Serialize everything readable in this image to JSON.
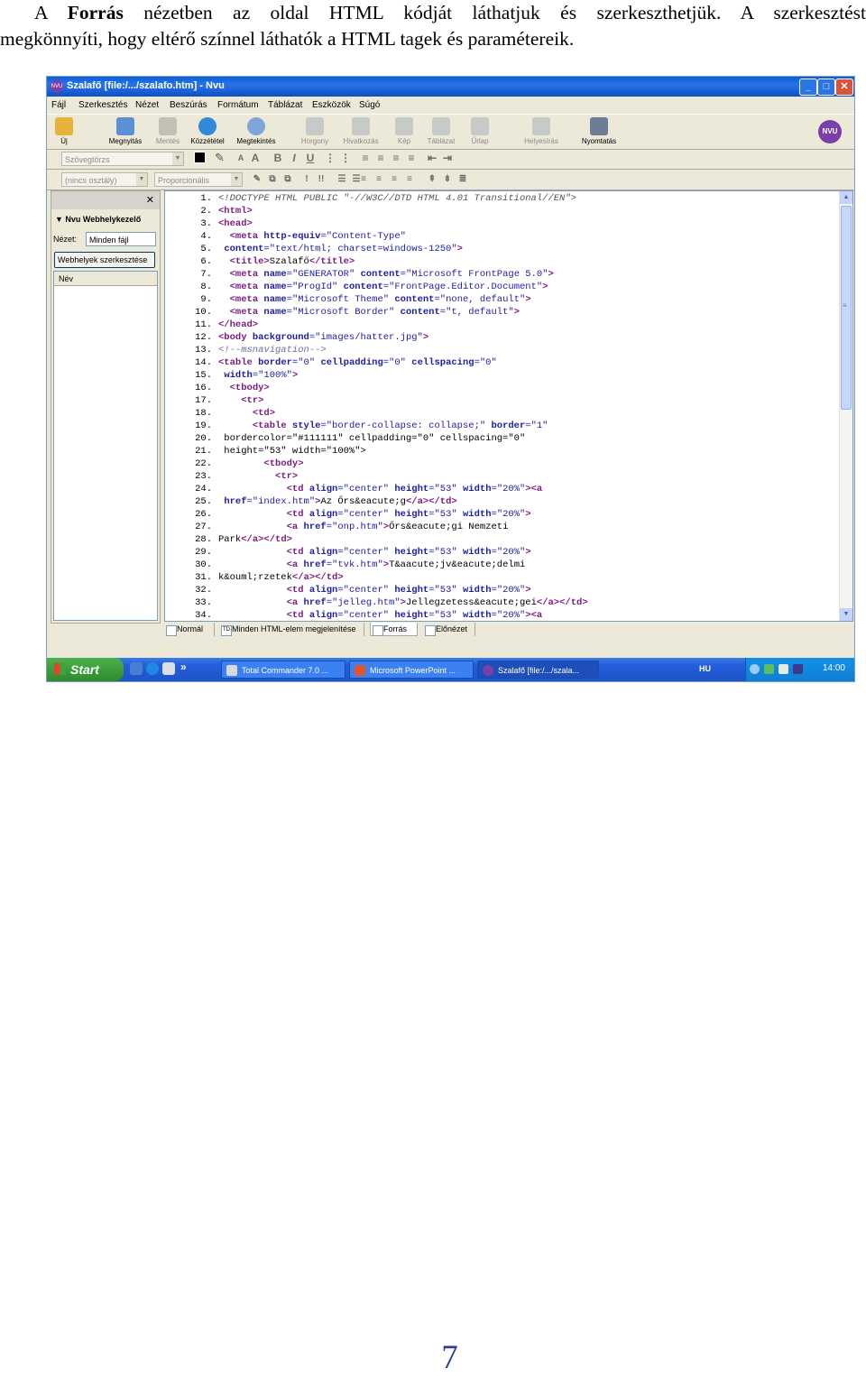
{
  "intro": {
    "p1": "A ",
    "bold": "Forrás",
    "p2": " nézetben az oldal HTML kódját láthatjuk és szerkeszthetjük. A szerkesztést",
    "line2": "megkönnyíti, hogy eltérő színnel láthatók a HTML tagek és paramétereik."
  },
  "window": {
    "title": "Szalafő [file:/.../szalafo.htm] - Nvu",
    "icon_text": "NVU",
    "minimize": "_",
    "maximize": "□",
    "close": "✕"
  },
  "menu": [
    "Fájl",
    "Szerkesztés",
    "Nézet",
    "Beszúrás",
    "Formátum",
    "Táblázat",
    "Eszközök",
    "Súgó"
  ],
  "toolbar": [
    {
      "label": "Új",
      "icon": "new-file-icon",
      "color": "#e8b23a",
      "enabled": true
    },
    {
      "label": "Megnyitás",
      "icon": "open-folder-icon",
      "color": "#5b8fd6",
      "enabled": true
    },
    {
      "label": "Mentés",
      "icon": "save-disk-icon",
      "color": "#8d8d8d",
      "enabled": false
    },
    {
      "label": "Közzététel",
      "icon": "publish-globe-icon",
      "color": "#2f8ad8",
      "enabled": true
    },
    {
      "label": "Megtekintés",
      "icon": "browse-magnifier-icon",
      "color": "#7ea6d8",
      "enabled": true
    },
    {
      "label": "Horgony",
      "icon": "anchor-icon",
      "color": "#9aa7b8",
      "enabled": false
    },
    {
      "label": "Hivatkozás",
      "icon": "link-chain-icon",
      "color": "#9aa7b8",
      "enabled": false
    },
    {
      "label": "Kép",
      "icon": "image-icon",
      "color": "#9aa7b8",
      "enabled": false
    },
    {
      "label": "Táblázat",
      "icon": "table-icon",
      "color": "#9aa7b8",
      "enabled": false
    },
    {
      "label": "Űrlap",
      "icon": "form-icon",
      "color": "#9aa7b8",
      "enabled": false
    },
    {
      "label": "Helyesírás",
      "icon": "spellcheck-icon",
      "color": "#9aa7b8",
      "enabled": false
    },
    {
      "label": "Nyomtatás",
      "icon": "printer-icon",
      "color": "#6d7d95",
      "enabled": true
    }
  ],
  "nvu_logo": "NVU",
  "format": {
    "paragraph_placeholder": "Szövegtörzs",
    "class_placeholder": "(nincs osztály)",
    "font_placeholder": "Proporcionális",
    "buttons_row2": [
      "A",
      "A",
      "B",
      "I",
      "U",
      "⋮",
      "⋮",
      "≡",
      "≡",
      "≡",
      "≡",
      "⇤",
      "⇥"
    ],
    "buttons_row3": [
      "✎",
      "⧉",
      "⧉",
      "!",
      "!!",
      "☰",
      "☰",
      "≡",
      "≡",
      "≡",
      "≡",
      "↕",
      "↔",
      "↕",
      "⇞",
      "⇟",
      "≣"
    ]
  },
  "sidebar": {
    "close": "✕",
    "manager_title": "▼ Nvu Webhelykezelő",
    "view_label": "Nézet:",
    "view_value": "Minden fájl",
    "edit_sites_button": "Webhelyek szerkesztése",
    "column_name": "Név"
  },
  "code_lines": [
    {
      "n": "1.",
      "parts": [
        {
          "c": "c-dt",
          "t": "<!DOCTYPE HTML PUBLIC \"-//W3C//DTD HTML 4.01 Transitional//EN\">"
        }
      ]
    },
    {
      "n": "2.",
      "parts": [
        {
          "c": "c-tag",
          "t": "<html>"
        }
      ]
    },
    {
      "n": "3.",
      "parts": [
        {
          "c": "c-tag",
          "t": "<head>"
        }
      ]
    },
    {
      "n": "4.",
      "parts": [
        {
          "c": "c-tx",
          "t": "  "
        },
        {
          "c": "c-tag",
          "t": "<meta "
        },
        {
          "c": "c-at",
          "t": "http-equiv"
        },
        {
          "c": "c-val",
          "t": "=\"Content-Type\""
        }
      ]
    },
    {
      "n": "5.",
      "parts": [
        {
          "c": "c-tx",
          "t": " "
        },
        {
          "c": "c-at",
          "t": "content"
        },
        {
          "c": "c-val",
          "t": "=\"text/html; charset=windows-1250\""
        },
        {
          "c": "c-tag",
          "t": ">"
        }
      ]
    },
    {
      "n": "6.",
      "parts": [
        {
          "c": "c-tx",
          "t": "  "
        },
        {
          "c": "c-tag",
          "t": "<title>"
        },
        {
          "c": "c-tx",
          "t": "Szalafő"
        },
        {
          "c": "c-tag",
          "t": "</title>"
        }
      ]
    },
    {
      "n": "7.",
      "parts": [
        {
          "c": "c-tx",
          "t": "  "
        },
        {
          "c": "c-tag",
          "t": "<meta "
        },
        {
          "c": "c-at",
          "t": "name"
        },
        {
          "c": "c-val",
          "t": "=\"GENERATOR\" "
        },
        {
          "c": "c-at",
          "t": "content"
        },
        {
          "c": "c-val",
          "t": "=\"Microsoft FrontPage 5.0\""
        },
        {
          "c": "c-tag",
          "t": ">"
        }
      ]
    },
    {
      "n": "8.",
      "parts": [
        {
          "c": "c-tx",
          "t": "  "
        },
        {
          "c": "c-tag",
          "t": "<meta "
        },
        {
          "c": "c-at",
          "t": "name"
        },
        {
          "c": "c-val",
          "t": "=\"ProgId\" "
        },
        {
          "c": "c-at",
          "t": "content"
        },
        {
          "c": "c-val",
          "t": "=\"FrontPage.Editor.Document\""
        },
        {
          "c": "c-tag",
          "t": ">"
        }
      ]
    },
    {
      "n": "9.",
      "parts": [
        {
          "c": "c-tx",
          "t": "  "
        },
        {
          "c": "c-tag",
          "t": "<meta "
        },
        {
          "c": "c-at",
          "t": "name"
        },
        {
          "c": "c-val",
          "t": "=\"Microsoft Theme\" "
        },
        {
          "c": "c-at",
          "t": "content"
        },
        {
          "c": "c-val",
          "t": "=\"none, default\""
        },
        {
          "c": "c-tag",
          "t": ">"
        }
      ]
    },
    {
      "n": "10.",
      "parts": [
        {
          "c": "c-tx",
          "t": "  "
        },
        {
          "c": "c-tag",
          "t": "<meta "
        },
        {
          "c": "c-at",
          "t": "name"
        },
        {
          "c": "c-val",
          "t": "=\"Microsoft Border\" "
        },
        {
          "c": "c-at",
          "t": "content"
        },
        {
          "c": "c-val",
          "t": "=\"t, default\""
        },
        {
          "c": "c-tag",
          "t": ">"
        }
      ]
    },
    {
      "n": "11.",
      "parts": [
        {
          "c": "c-tag",
          "t": "</head>"
        }
      ]
    },
    {
      "n": "12.",
      "parts": [
        {
          "c": "c-tag",
          "t": "<body "
        },
        {
          "c": "c-at",
          "t": "background"
        },
        {
          "c": "c-val",
          "t": "=\"images/hatter.jpg\""
        },
        {
          "c": "c-tag",
          "t": ">"
        }
      ]
    },
    {
      "n": "13.",
      "parts": [
        {
          "c": "c-cm",
          "t": "<!--msnavigation-->"
        }
      ]
    },
    {
      "n": "14.",
      "parts": [
        {
          "c": "c-tag",
          "t": "<table "
        },
        {
          "c": "c-at",
          "t": "border"
        },
        {
          "c": "c-val",
          "t": "=\"0\" "
        },
        {
          "c": "c-at",
          "t": "cellpadding"
        },
        {
          "c": "c-val",
          "t": "=\"0\" "
        },
        {
          "c": "c-at",
          "t": "cellspacing"
        },
        {
          "c": "c-val",
          "t": "=\"0\""
        }
      ]
    },
    {
      "n": "15.",
      "parts": [
        {
          "c": "c-tx",
          "t": " "
        },
        {
          "c": "c-at",
          "t": "width"
        },
        {
          "c": "c-val",
          "t": "=\"100%\""
        },
        {
          "c": "c-tag",
          "t": ">"
        }
      ]
    },
    {
      "n": "16.",
      "parts": [
        {
          "c": "c-tx",
          "t": "  "
        },
        {
          "c": "c-tag",
          "t": "<tbody>"
        }
      ]
    },
    {
      "n": "17.",
      "parts": [
        {
          "c": "c-tx",
          "t": "    "
        },
        {
          "c": "c-tag",
          "t": "<tr>"
        }
      ]
    },
    {
      "n": "18.",
      "parts": [
        {
          "c": "c-tx",
          "t": "      "
        },
        {
          "c": "c-tag",
          "t": "<td>"
        }
      ]
    },
    {
      "n": "19.",
      "parts": [
        {
          "c": "c-tx",
          "t": "      "
        },
        {
          "c": "c-tag",
          "t": "<table "
        },
        {
          "c": "c-at",
          "t": "style"
        },
        {
          "c": "c-val",
          "t": "=\"border-collapse: collapse;\" "
        },
        {
          "c": "c-at",
          "t": "border"
        },
        {
          "c": "c-val",
          "t": "=\"1\""
        }
      ]
    },
    {
      "n": "20.",
      "parts": [
        {
          "c": "c-tx",
          "t": " bordercolor=\"#111111\" cellpadding=\"0\" cellspacing=\"0\""
        }
      ]
    },
    {
      "n": "21.",
      "parts": [
        {
          "c": "c-tx",
          "t": " height=\"53\" width=\"100%\">"
        }
      ]
    },
    {
      "n": "22.",
      "parts": [
        {
          "c": "c-tx",
          "t": "        "
        },
        {
          "c": "c-tag",
          "t": "<tbody>"
        }
      ]
    },
    {
      "n": "23.",
      "parts": [
        {
          "c": "c-tx",
          "t": "          "
        },
        {
          "c": "c-tag",
          "t": "<tr>"
        }
      ]
    },
    {
      "n": "24.",
      "parts": [
        {
          "c": "c-tx",
          "t": "            "
        },
        {
          "c": "c-tag",
          "t": "<td "
        },
        {
          "c": "c-at",
          "t": "align"
        },
        {
          "c": "c-val",
          "t": "=\"center\" "
        },
        {
          "c": "c-at",
          "t": "height"
        },
        {
          "c": "c-val",
          "t": "=\"53\" "
        },
        {
          "c": "c-at",
          "t": "width"
        },
        {
          "c": "c-val",
          "t": "=\"20%\""
        },
        {
          "c": "c-tag",
          "t": "><a"
        }
      ]
    },
    {
      "n": "25.",
      "parts": [
        {
          "c": "c-tx",
          "t": " "
        },
        {
          "c": "c-at",
          "t": "href"
        },
        {
          "c": "c-val",
          "t": "=\"index.htm\""
        },
        {
          "c": "c-tag",
          "t": ">"
        },
        {
          "c": "c-tx",
          "t": "Az Őrs&eacute;g"
        },
        {
          "c": "c-tag",
          "t": "</a></td>"
        }
      ]
    },
    {
      "n": "26.",
      "parts": [
        {
          "c": "c-tx",
          "t": "            "
        },
        {
          "c": "c-tag",
          "t": "<td "
        },
        {
          "c": "c-at",
          "t": "align"
        },
        {
          "c": "c-val",
          "t": "=\"center\" "
        },
        {
          "c": "c-at",
          "t": "height"
        },
        {
          "c": "c-val",
          "t": "=\"53\" "
        },
        {
          "c": "c-at",
          "t": "width"
        },
        {
          "c": "c-val",
          "t": "=\"20%\""
        },
        {
          "c": "c-tag",
          "t": ">"
        }
      ]
    },
    {
      "n": "27.",
      "parts": [
        {
          "c": "c-tx",
          "t": "            "
        },
        {
          "c": "c-tag",
          "t": "<a "
        },
        {
          "c": "c-at",
          "t": "href"
        },
        {
          "c": "c-val",
          "t": "=\"onp.htm\""
        },
        {
          "c": "c-tag",
          "t": ">"
        },
        {
          "c": "c-tx",
          "t": "Őrs&eacute;gi Nemzeti"
        }
      ]
    },
    {
      "n": "28.",
      "parts": [
        {
          "c": "c-tx",
          "t": "Park"
        },
        {
          "c": "c-tag",
          "t": "</a></td>"
        }
      ]
    },
    {
      "n": "29.",
      "parts": [
        {
          "c": "c-tx",
          "t": "            "
        },
        {
          "c": "c-tag",
          "t": "<td "
        },
        {
          "c": "c-at",
          "t": "align"
        },
        {
          "c": "c-val",
          "t": "=\"center\" "
        },
        {
          "c": "c-at",
          "t": "height"
        },
        {
          "c": "c-val",
          "t": "=\"53\" "
        },
        {
          "c": "c-at",
          "t": "width"
        },
        {
          "c": "c-val",
          "t": "=\"20%\""
        },
        {
          "c": "c-tag",
          "t": ">"
        }
      ]
    },
    {
      "n": "30.",
      "parts": [
        {
          "c": "c-tx",
          "t": "            "
        },
        {
          "c": "c-tag",
          "t": "<a "
        },
        {
          "c": "c-at",
          "t": "href"
        },
        {
          "c": "c-val",
          "t": "=\"tvk.htm\""
        },
        {
          "c": "c-tag",
          "t": ">"
        },
        {
          "c": "c-tx",
          "t": "T&aacute;jv&eacute;delmi"
        }
      ]
    },
    {
      "n": "31.",
      "parts": [
        {
          "c": "c-tx",
          "t": "k&ouml;rzetek"
        },
        {
          "c": "c-tag",
          "t": "</a></td>"
        }
      ]
    },
    {
      "n": "32.",
      "parts": [
        {
          "c": "c-tx",
          "t": "            "
        },
        {
          "c": "c-tag",
          "t": "<td "
        },
        {
          "c": "c-at",
          "t": "align"
        },
        {
          "c": "c-val",
          "t": "=\"center\" "
        },
        {
          "c": "c-at",
          "t": "height"
        },
        {
          "c": "c-val",
          "t": "=\"53\" "
        },
        {
          "c": "c-at",
          "t": "width"
        },
        {
          "c": "c-val",
          "t": "=\"20%\""
        },
        {
          "c": "c-tag",
          "t": ">"
        }
      ]
    },
    {
      "n": "33.",
      "parts": [
        {
          "c": "c-tx",
          "t": "            "
        },
        {
          "c": "c-tag",
          "t": "<a "
        },
        {
          "c": "c-at",
          "t": "href"
        },
        {
          "c": "c-val",
          "t": "=\"jelleg.htm\""
        },
        {
          "c": "c-tag",
          "t": ">"
        },
        {
          "c": "c-tx",
          "t": "Jellegzetess&eacute;gei"
        },
        {
          "c": "c-tag",
          "t": "</a></td>"
        }
      ]
    },
    {
      "n": "34.",
      "parts": [
        {
          "c": "c-tx",
          "t": "            "
        },
        {
          "c": "c-tag",
          "t": "<td "
        },
        {
          "c": "c-at",
          "t": "align"
        },
        {
          "c": "c-val",
          "t": "=\"center\" "
        },
        {
          "c": "c-at",
          "t": "height"
        },
        {
          "c": "c-val",
          "t": "=\"53\" "
        },
        {
          "c": "c-at",
          "t": "width"
        },
        {
          "c": "c-val",
          "t": "=\"20%\""
        },
        {
          "c": "c-tag",
          "t": "><a"
        }
      ]
    }
  ],
  "scroll": {
    "up": "▲",
    "down": "▼",
    "grip": "≡"
  },
  "tabs": [
    {
      "label": "Normál",
      "icon": "normal-view-icon",
      "active": false
    },
    {
      "label": "Minden HTML-elem megjelenítése",
      "icon": "td-tags-icon",
      "active": false
    },
    {
      "label": "Forrás",
      "icon": "source-view-icon",
      "active": true
    },
    {
      "label": "Előnézet",
      "icon": "preview-icon",
      "active": false
    }
  ],
  "taskbar": {
    "start": "Start",
    "quicklaunch_more": "»",
    "tasks": [
      {
        "label": "Total Commander 7.0 ...",
        "icon": "total-commander-icon",
        "color": "#d9d9d9"
      },
      {
        "label": "Microsoft PowerPoint ...",
        "icon": "powerpoint-icon",
        "color": "#e0552a"
      },
      {
        "label": "Szalafő [file:/.../szala...",
        "icon": "nvu-icon",
        "color": "#7b3fa8"
      }
    ],
    "lang": "HU",
    "clock": "14:00"
  },
  "page_number": "7",
  "colors": {
    "tag": "#7b1b7e",
    "attribute": "#1e1e9e",
    "comment": "#6b6b9e",
    "doctype": "#555555"
  }
}
